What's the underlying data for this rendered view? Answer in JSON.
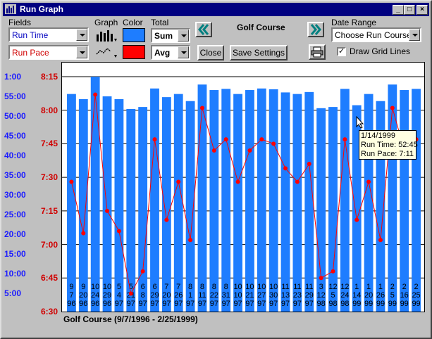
{
  "window": {
    "title": "Run Graph"
  },
  "controls": {
    "fields_label": "Fields",
    "field1": "Run Time",
    "field2": "Run Pace",
    "graph_label": "Graph",
    "color_label": "Color",
    "total_label": "Total",
    "total1": "Sum",
    "total2": "Avg",
    "close_label": "Close",
    "save_label": "Save Settings",
    "course_name": "Golf Course",
    "date_range_label": "Date Range",
    "date_range_value": "Choose Run Course...",
    "grid_label": "Draw Grid Lines",
    "grid_checked": true
  },
  "colors": {
    "series1": "#1e7dff",
    "series2": "#ff0000",
    "title_bar": "#000080"
  },
  "icons": {
    "app": "bar-chart-icon",
    "prev": "double-chevron-left-icon",
    "next": "double-chevron-right-icon",
    "print": "printer-icon",
    "graph1": "bar-graph-icon",
    "graph2": "line-graph-icon"
  },
  "chart_data": {
    "type": "bar",
    "caption": "Golf Course (9/7/1996 - 2/25/1999)",
    "categories": [
      "9/7/96",
      "9/20/96",
      "10/24/96",
      "10/29/96",
      "5/4/97",
      "5/21/97",
      "6/8/97",
      "6/29/97",
      "7/20/97",
      "7/26/97",
      "8/1/97",
      "8/11/97",
      "8/22/97",
      "8/31/97",
      "10/10/97",
      "10/21/97",
      "10/27/97",
      "10/30/97",
      "11/13/97",
      "11/23/97",
      "11/29/97",
      "3/12/98",
      "12/5/98",
      "12/24/98",
      "1/14/99",
      "1/20/99",
      "1/26/99",
      "2/5/99",
      "2/16/99",
      "2/25/99"
    ],
    "category_lines": [
      [
        "9",
        "7",
        "96"
      ],
      [
        "9",
        "20",
        "96"
      ],
      [
        "10",
        "24",
        "96"
      ],
      [
        "10",
        "29",
        "96"
      ],
      [
        "5",
        "4",
        "97"
      ],
      [
        "5",
        "21",
        "97"
      ],
      [
        "6",
        "8",
        "97"
      ],
      [
        "6",
        "29",
        "97"
      ],
      [
        "7",
        "20",
        "97"
      ],
      [
        "7",
        "26",
        "97"
      ],
      [
        "8",
        "1",
        "97"
      ],
      [
        "8",
        "11",
        "97"
      ],
      [
        "8",
        "22",
        "97"
      ],
      [
        "8",
        "31",
        "97"
      ],
      [
        "10",
        "10",
        "97"
      ],
      [
        "10",
        "21",
        "97"
      ],
      [
        "10",
        "27",
        "97"
      ],
      [
        "10",
        "30",
        "97"
      ],
      [
        "11",
        "13",
        "97"
      ],
      [
        "11",
        "23",
        "97"
      ],
      [
        "11",
        "29",
        "97"
      ],
      [
        "3",
        "12",
        "98"
      ],
      [
        "12",
        "5",
        "98"
      ],
      [
        "12",
        "24",
        "98"
      ],
      [
        "1",
        "14",
        "99"
      ],
      [
        "1",
        "20",
        "99"
      ],
      [
        "1",
        "26",
        "99"
      ],
      [
        "2",
        "5",
        "99"
      ],
      [
        "2",
        "16",
        "99"
      ],
      [
        "2",
        "25",
        "99"
      ]
    ],
    "series": [
      {
        "name": "Run Time",
        "axis": "left",
        "type": "bar",
        "values": [
          55.6,
          54.3,
          60.0,
          55.0,
          54.3,
          51.8,
          52.3,
          57.0,
          54.8,
          55.6,
          53.8,
          58.0,
          56.6,
          56.9,
          55.6,
          56.6,
          57.0,
          56.8,
          56.0,
          55.6,
          56.1,
          52.0,
          52.3,
          56.9,
          52.75,
          55.6,
          53.8,
          58.0,
          56.6,
          56.9
        ]
      },
      {
        "name": "Run Pace",
        "axis": "right",
        "type": "line",
        "values": [
          "7:28",
          "7:05",
          "8:07",
          "7:15",
          "7:06",
          "6:38",
          "6:48",
          "7:47",
          "7:11",
          "7:28",
          "7:02",
          "8:01",
          "7:42",
          "7:47",
          "7:28",
          "7:42",
          "7:47",
          "7:45",
          "7:34",
          "7:28",
          "7:36",
          "6:45",
          "6:48",
          "7:47",
          "7:11",
          "7:28",
          "7:02",
          "8:01",
          "7:42",
          "7:47"
        ]
      }
    ],
    "left_axis": {
      "ticks": [
        "1:00",
        "55:00",
        "50:00",
        "45:00",
        "40:00",
        "35:00",
        "30:00",
        "25:00",
        "20:00",
        "15:00",
        "10:00",
        "5:00"
      ],
      "range": [
        5,
        60
      ]
    },
    "right_axis": {
      "ticks": [
        "8:15",
        "8:00",
        "7:45",
        "7:30",
        "7:15",
        "7:00",
        "6:45",
        "6:30"
      ],
      "range": [
        "6:30",
        "8:15"
      ]
    },
    "grid": true
  },
  "tooltip": {
    "date": "1/14/1999",
    "time_line": "Run Time: 52:45",
    "pace_line": "Run Pace: 7:11"
  }
}
